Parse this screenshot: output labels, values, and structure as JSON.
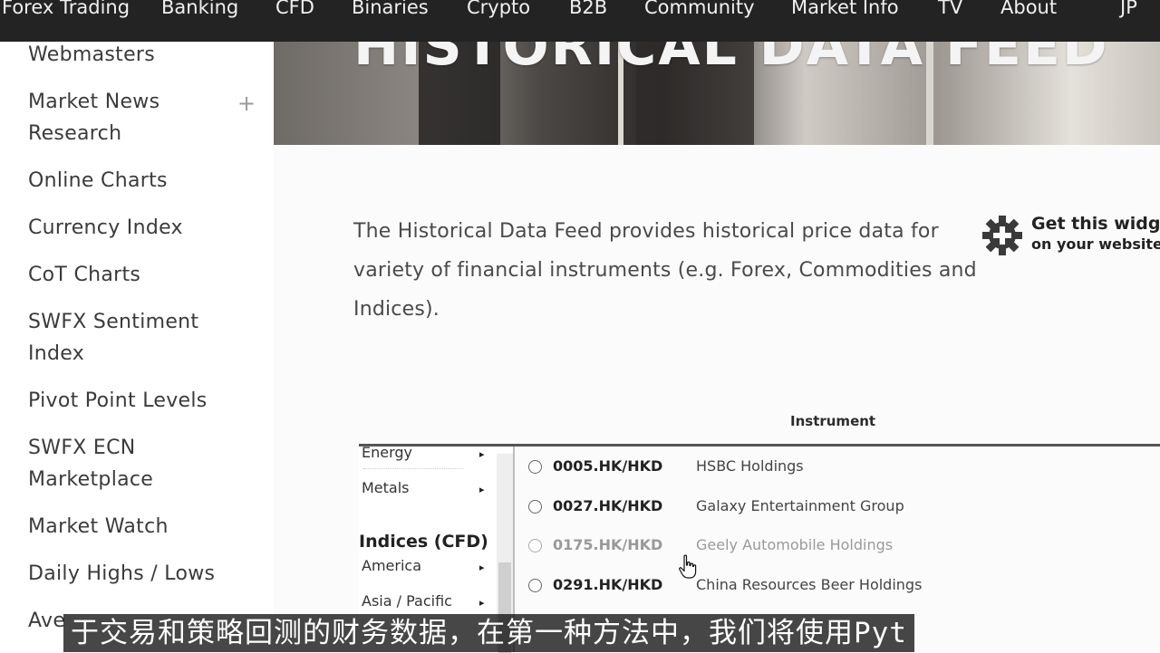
{
  "nav": {
    "items": [
      "Forex Trading",
      "Banking",
      "CFD",
      "Binaries",
      "Crypto",
      "B2B",
      "Community",
      "Market Info",
      "TV",
      "About",
      "JP"
    ]
  },
  "sidebar": {
    "items": [
      "Webmasters",
      "Market News Research",
      "Online Charts",
      "Currency Index",
      "CoT Charts",
      "SWFX Sentiment Index",
      "Pivot Point Levels",
      "SWFX ECN Marketplace",
      "Market Watch",
      "Daily Highs / Lows",
      "Ave"
    ],
    "expand_symbol": "+"
  },
  "hero": {
    "title": "HISTORICAL DATA FEED"
  },
  "intro": {
    "text": "The Historical Data Feed provides historical price data for variety of financial instruments (e.g. Forex, Commodities and Indices)."
  },
  "widget": {
    "line1": "Get this widg",
    "line2": "on your website"
  },
  "instrument": {
    "header": "Instrument",
    "categories": [
      {
        "label": "Energy",
        "arrow": "▸"
      },
      {
        "label": "Metals",
        "arrow": "▸"
      },
      {
        "label": "America",
        "arrow": "▸"
      },
      {
        "label": "Asia / Pacific",
        "arrow": "▸"
      }
    ],
    "section_heading": "Indices (CFD)",
    "rows": [
      {
        "code": "0005.HK/HKD",
        "name": "HSBC Holdings"
      },
      {
        "code": "0027.HK/HKD",
        "name": "Galaxy Entertainment Group"
      },
      {
        "code": "0175.HK/HKD",
        "name": "Geely Automobile Holdings"
      },
      {
        "code": "0291.HK/HKD",
        "name": "China Resources Beer Holdings"
      }
    ]
  },
  "subtitle": {
    "text": "于交易和策略回测的财务数据，在第一种方法中，我们将使用Pyt"
  }
}
